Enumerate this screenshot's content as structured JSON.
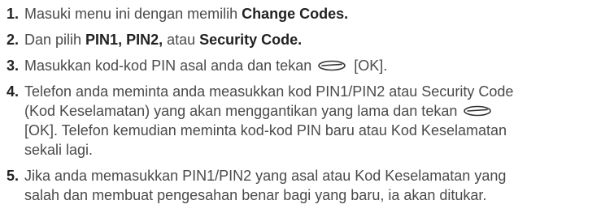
{
  "steps": [
    {
      "number": "1.",
      "before": "Masuki menu ini dengan memilih ",
      "bold": "Change Codes."
    },
    {
      "number": "2.",
      "before": "Dan pilih ",
      "bold1": "PIN1, PIN2,",
      "middle": " atau ",
      "bold2": "Security Code."
    },
    {
      "number": "3.",
      "before": "Masukkan kod-kod PIN asal anda dan tekan ",
      "icon": "soft-key-icon",
      "after": " [OK]."
    },
    {
      "number": "4.",
      "line1": "Telefon anda meminta anda measukkan kod PIN1/PIN2 atau Security Code",
      "line2_before": "(Kod Keselamatan) yang akan menggantikan yang lama dan tekan ",
      "icon": "soft-key-icon",
      "line3": "[OK]. Telefon kemudian meminta kod-kod PIN baru atau Kod Keselamatan",
      "line4": "sekali lagi."
    },
    {
      "number": "5.",
      "line1": "Jika anda memasukkan PIN1/PIN2 yang asal atau Kod Keselamatan yang",
      "line2": "salah dan membuat pengesahan benar bagi yang baru, ia akan ditukar."
    }
  ],
  "colors": {
    "text": "#4a4a4a",
    "bold": "#222222",
    "background": "#ffffff"
  }
}
